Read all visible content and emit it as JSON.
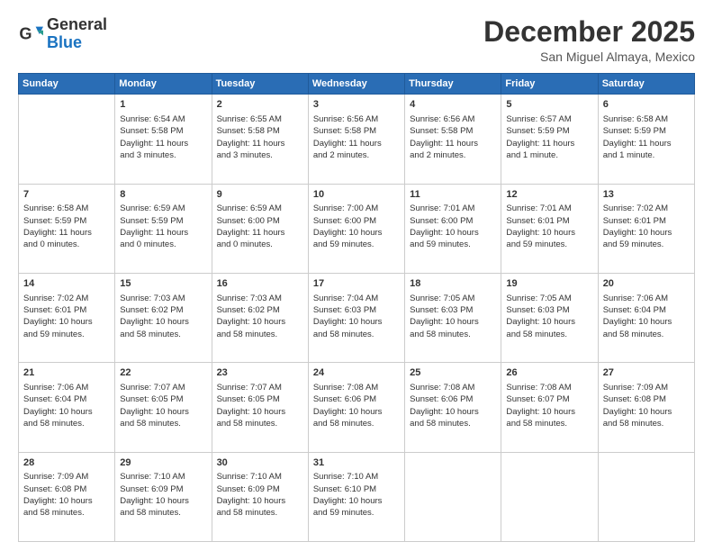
{
  "logo": {
    "line1": "General",
    "line2": "Blue"
  },
  "title": "December 2025",
  "location": "San Miguel Almaya, Mexico",
  "days_header": [
    "Sunday",
    "Monday",
    "Tuesday",
    "Wednesday",
    "Thursday",
    "Friday",
    "Saturday"
  ],
  "weeks": [
    [
      {
        "date": "",
        "info": ""
      },
      {
        "date": "1",
        "info": "Sunrise: 6:54 AM\nSunset: 5:58 PM\nDaylight: 11 hours\nand 3 minutes."
      },
      {
        "date": "2",
        "info": "Sunrise: 6:55 AM\nSunset: 5:58 PM\nDaylight: 11 hours\nand 3 minutes."
      },
      {
        "date": "3",
        "info": "Sunrise: 6:56 AM\nSunset: 5:58 PM\nDaylight: 11 hours\nand 2 minutes."
      },
      {
        "date": "4",
        "info": "Sunrise: 6:56 AM\nSunset: 5:58 PM\nDaylight: 11 hours\nand 2 minutes."
      },
      {
        "date": "5",
        "info": "Sunrise: 6:57 AM\nSunset: 5:59 PM\nDaylight: 11 hours\nand 1 minute."
      },
      {
        "date": "6",
        "info": "Sunrise: 6:58 AM\nSunset: 5:59 PM\nDaylight: 11 hours\nand 1 minute."
      }
    ],
    [
      {
        "date": "7",
        "info": "Sunrise: 6:58 AM\nSunset: 5:59 PM\nDaylight: 11 hours\nand 0 minutes."
      },
      {
        "date": "8",
        "info": "Sunrise: 6:59 AM\nSunset: 5:59 PM\nDaylight: 11 hours\nand 0 minutes."
      },
      {
        "date": "9",
        "info": "Sunrise: 6:59 AM\nSunset: 6:00 PM\nDaylight: 11 hours\nand 0 minutes."
      },
      {
        "date": "10",
        "info": "Sunrise: 7:00 AM\nSunset: 6:00 PM\nDaylight: 10 hours\nand 59 minutes."
      },
      {
        "date": "11",
        "info": "Sunrise: 7:01 AM\nSunset: 6:00 PM\nDaylight: 10 hours\nand 59 minutes."
      },
      {
        "date": "12",
        "info": "Sunrise: 7:01 AM\nSunset: 6:01 PM\nDaylight: 10 hours\nand 59 minutes."
      },
      {
        "date": "13",
        "info": "Sunrise: 7:02 AM\nSunset: 6:01 PM\nDaylight: 10 hours\nand 59 minutes."
      }
    ],
    [
      {
        "date": "14",
        "info": "Sunrise: 7:02 AM\nSunset: 6:01 PM\nDaylight: 10 hours\nand 59 minutes."
      },
      {
        "date": "15",
        "info": "Sunrise: 7:03 AM\nSunset: 6:02 PM\nDaylight: 10 hours\nand 58 minutes."
      },
      {
        "date": "16",
        "info": "Sunrise: 7:03 AM\nSunset: 6:02 PM\nDaylight: 10 hours\nand 58 minutes."
      },
      {
        "date": "17",
        "info": "Sunrise: 7:04 AM\nSunset: 6:03 PM\nDaylight: 10 hours\nand 58 minutes."
      },
      {
        "date": "18",
        "info": "Sunrise: 7:05 AM\nSunset: 6:03 PM\nDaylight: 10 hours\nand 58 minutes."
      },
      {
        "date": "19",
        "info": "Sunrise: 7:05 AM\nSunset: 6:03 PM\nDaylight: 10 hours\nand 58 minutes."
      },
      {
        "date": "20",
        "info": "Sunrise: 7:06 AM\nSunset: 6:04 PM\nDaylight: 10 hours\nand 58 minutes."
      }
    ],
    [
      {
        "date": "21",
        "info": "Sunrise: 7:06 AM\nSunset: 6:04 PM\nDaylight: 10 hours\nand 58 minutes."
      },
      {
        "date": "22",
        "info": "Sunrise: 7:07 AM\nSunset: 6:05 PM\nDaylight: 10 hours\nand 58 minutes."
      },
      {
        "date": "23",
        "info": "Sunrise: 7:07 AM\nSunset: 6:05 PM\nDaylight: 10 hours\nand 58 minutes."
      },
      {
        "date": "24",
        "info": "Sunrise: 7:08 AM\nSunset: 6:06 PM\nDaylight: 10 hours\nand 58 minutes."
      },
      {
        "date": "25",
        "info": "Sunrise: 7:08 AM\nSunset: 6:06 PM\nDaylight: 10 hours\nand 58 minutes."
      },
      {
        "date": "26",
        "info": "Sunrise: 7:08 AM\nSunset: 6:07 PM\nDaylight: 10 hours\nand 58 minutes."
      },
      {
        "date": "27",
        "info": "Sunrise: 7:09 AM\nSunset: 6:08 PM\nDaylight: 10 hours\nand 58 minutes."
      }
    ],
    [
      {
        "date": "28",
        "info": "Sunrise: 7:09 AM\nSunset: 6:08 PM\nDaylight: 10 hours\nand 58 minutes."
      },
      {
        "date": "29",
        "info": "Sunrise: 7:10 AM\nSunset: 6:09 PM\nDaylight: 10 hours\nand 58 minutes."
      },
      {
        "date": "30",
        "info": "Sunrise: 7:10 AM\nSunset: 6:09 PM\nDaylight: 10 hours\nand 58 minutes."
      },
      {
        "date": "31",
        "info": "Sunrise: 7:10 AM\nSunset: 6:10 PM\nDaylight: 10 hours\nand 59 minutes."
      },
      {
        "date": "",
        "info": ""
      },
      {
        "date": "",
        "info": ""
      },
      {
        "date": "",
        "info": ""
      }
    ]
  ]
}
